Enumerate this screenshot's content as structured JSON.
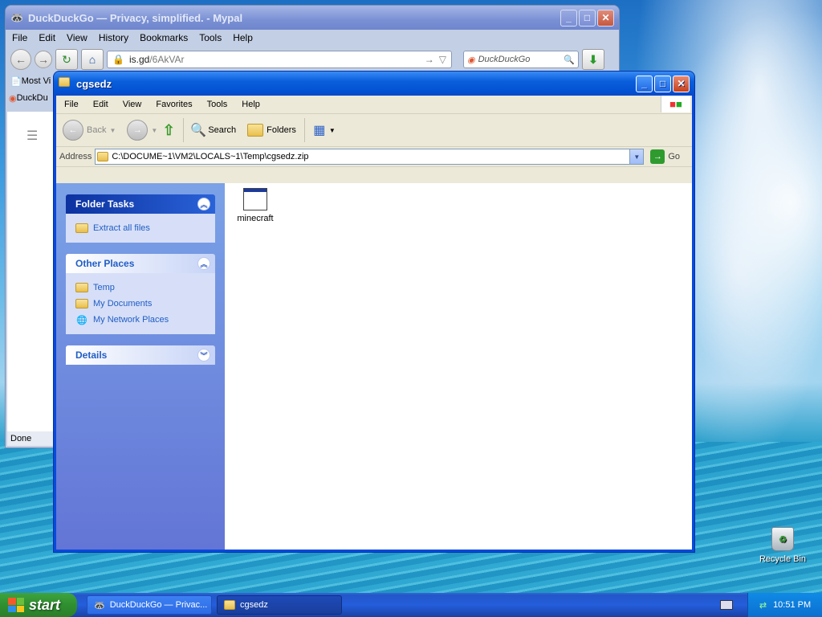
{
  "firefox": {
    "title": "DuckDuckGo — Privacy, simplified. - Mypal",
    "menu": [
      "File",
      "Edit",
      "View",
      "History",
      "Bookmarks",
      "Tools",
      "Help"
    ],
    "url_host": "is.gd",
    "url_path": "/6AkVAr",
    "search_placeholder": "DuckDuckGo",
    "bookmark_label": "Most Vi",
    "tab_label": "DuckDu",
    "status": "Done"
  },
  "explorer": {
    "title": "cgsedz",
    "menu": [
      "File",
      "Edit",
      "View",
      "Favorites",
      "Tools",
      "Help"
    ],
    "toolbar": {
      "back": "Back",
      "search": "Search",
      "folders": "Folders"
    },
    "address_label": "Address",
    "address_value": "C:\\DOCUME~1\\VM2\\LOCALS~1\\Temp\\cgsedz.zip",
    "go_label": "Go",
    "folder_tasks": {
      "title": "Folder Tasks",
      "items": [
        "Extract all files"
      ]
    },
    "other_places": {
      "title": "Other Places",
      "items": [
        "Temp",
        "My Documents",
        "My Network Places"
      ]
    },
    "details": {
      "title": "Details"
    },
    "files": [
      {
        "name": "minecraft"
      }
    ]
  },
  "desktop": {
    "recycle_bin": "Recycle Bin"
  },
  "taskbar": {
    "start": "start",
    "tasks": [
      "DuckDuckGo — Privac...",
      "cgsedz"
    ],
    "clock": "10:51 PM"
  },
  "colors": {
    "xp_blue": "#0a49d9",
    "task_link": "#215dc6",
    "start_green": "#3ea33e"
  }
}
